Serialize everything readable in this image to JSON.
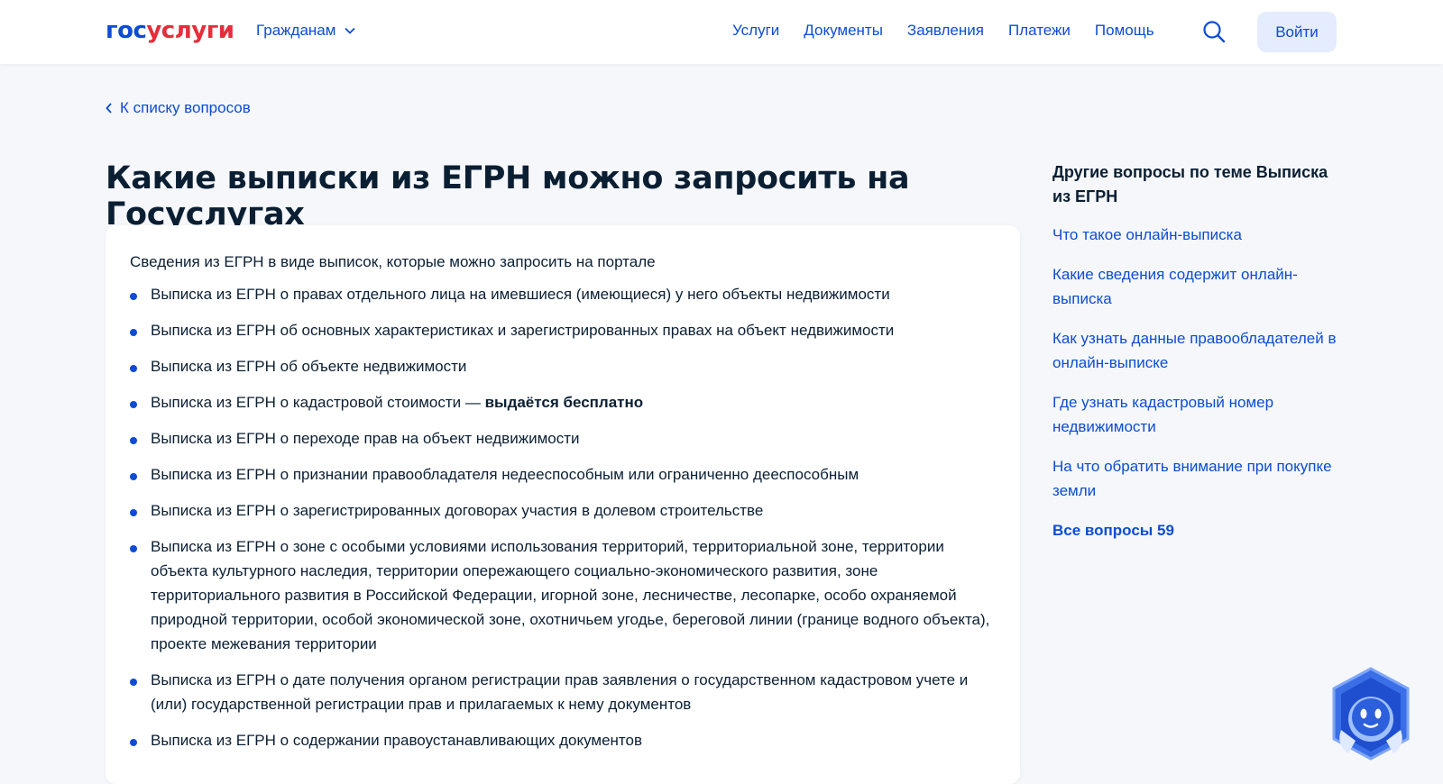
{
  "header": {
    "logo_part1": "гос",
    "logo_part2": "услуги",
    "citizens_label": "Гражданам",
    "nav": [
      "Услуги",
      "Документы",
      "Заявления",
      "Платежи",
      "Помощь"
    ],
    "login_label": "Войти"
  },
  "back_link": "К списку вопросов",
  "title": "Какие выписки из ЕГРН можно запросить на Госуслугах",
  "intro": "Сведения из ЕГРН в виде выписок, которые можно запросить на портале",
  "items": [
    "Выписка из ЕГРН о правах отдельного лица на имевшиеся (имеющиеся) у него объекты недвижимости",
    "Выписка из ЕГРН об основных характеристиках и зарегистрированных правах на объект недвижимости",
    "Выписка из ЕГРН об объекте недвижимости",
    "Выписка из ЕГРН о кадастровой стоимости — ",
    "Выписка из ЕГРН о переходе прав на объект недвижимости",
    "Выписка из ЕГРН о признании правообладателя недееспособным или ограниченно дееспособным",
    "Выписка из ЕГРН о зарегистрированных договорах участия в долевом строительстве",
    "Выписка из ЕГРН о зоне с особыми условиями использования территорий, территориальной зоне, территории объекта культурного наследия, территории опережающего социально-экономического развития, зоне территориального развития в Российской Федерации, игорной зоне, лесничестве, лесопарке, особо охраняемой природной территории, особой экономической зоне, охотничьем угодье, береговой линии (границе водного объекта), проекте межевания территории",
    "Выписка из ЕГРН о дате получения органом регистрации прав заявления о государственном кадастровом учете и (или) государственной регистрации прав и прилагаемых к нему документов",
    "Выписка из ЕГРН о содержании правоустанавливающих документов"
  ],
  "free_note": "выдаётся бесплатно",
  "aside": {
    "title": "Другие вопросы по теме Выписка из ЕГРН",
    "links": [
      "Что такое онлайн-выписка",
      "Какие сведения содержит онлайн-выписка",
      "Как узнать данные правообладателей в онлайн-выписке",
      "Где узнать кадастровый номер недвижимости",
      "На что обратить внимание при покупке земли"
    ],
    "all_label": "Все вопросы 59"
  },
  "colors": {
    "accent": "#0d4cd3",
    "brand_red": "#e52d3b",
    "text": "#0b1f33",
    "bg": "#f5f7fa"
  }
}
